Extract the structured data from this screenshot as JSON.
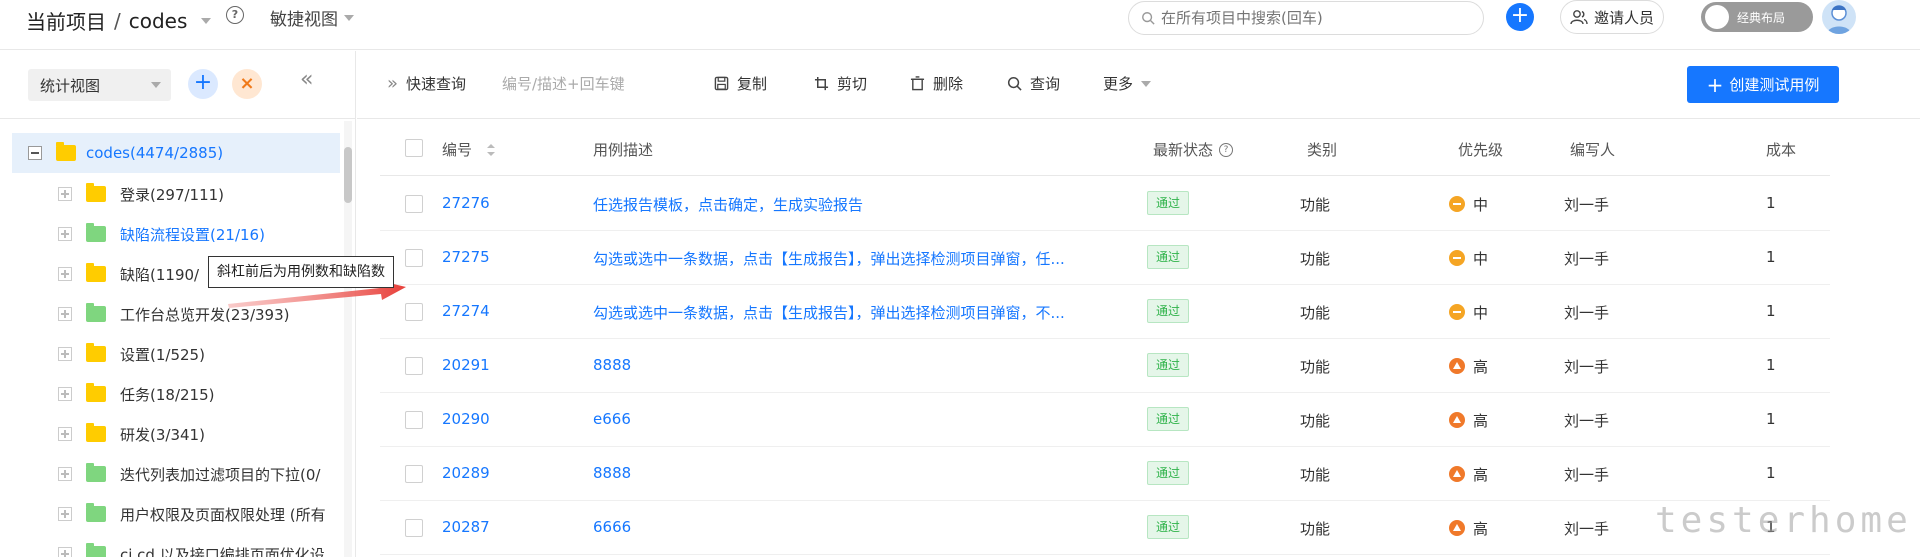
{
  "topbar": {
    "project_label": "当前项目",
    "separator": "/",
    "project_name": "codes",
    "help_icon": "question-circle-icon",
    "view_mode": "敏捷视图",
    "search_placeholder": "在所有项目中搜索(回车)",
    "invite_label": "邀请人员",
    "layout_toggle_label": "经典布局"
  },
  "sidebar": {
    "view_select": "统计视图",
    "root": {
      "label": "codes(4474/2885)"
    },
    "items": [
      {
        "label": "登录(297/111)",
        "color": "yellow",
        "link": false
      },
      {
        "label": "缺陷流程设置(21/16)",
        "color": "green",
        "link": true
      },
      {
        "label": "缺陷(1190/",
        "color": "yellow",
        "link": false
      },
      {
        "label": "工作台总览开发(23/393)",
        "color": "green",
        "link": false
      },
      {
        "label": "设置(1/525)",
        "color": "yellow",
        "link": false
      },
      {
        "label": "任务(18/215)",
        "color": "yellow",
        "link": false
      },
      {
        "label": "研发(3/341)",
        "color": "yellow",
        "link": false
      },
      {
        "label": "迭代列表加过滤项目的下拉(0/",
        "color": "green",
        "link": false
      },
      {
        "label": "用户权限及页面权限处理 (所有",
        "color": "green",
        "link": false
      },
      {
        "label": "ci cd 以及接口编排页面优化设",
        "color": "green",
        "link": false
      }
    ]
  },
  "toolbar": {
    "quick_query": "快速查询",
    "quick_query_placeholder": "编号/描述+回车键",
    "copy": "复制",
    "cut": "剪切",
    "delete": "删除",
    "query": "查询",
    "more": "更多",
    "create": "创建测试用例"
  },
  "table": {
    "headers": {
      "id": "编号",
      "desc": "用例描述",
      "status": "最新状态",
      "category": "类别",
      "priority": "优先级",
      "author": "编写人",
      "cost": "成本"
    },
    "rows": [
      {
        "id": "27276",
        "desc": "任选报告模板，点击确定，生成实验报告",
        "status": "通过",
        "category": "功能",
        "priority": "中",
        "priority_level": "mid",
        "author": "刘一手",
        "cost": "1"
      },
      {
        "id": "27275",
        "desc": "勾选或选中一条数据，点击【生成报告】，弹出选择检测项目弹窗，任...",
        "status": "通过",
        "category": "功能",
        "priority": "中",
        "priority_level": "mid",
        "author": "刘一手",
        "cost": "1"
      },
      {
        "id": "27274",
        "desc": "勾选或选中一条数据，点击【生成报告】，弹出选择检测项目弹窗，不...",
        "status": "通过",
        "category": "功能",
        "priority": "中",
        "priority_level": "mid",
        "author": "刘一手",
        "cost": "1"
      },
      {
        "id": "20291",
        "desc": "8888",
        "status": "通过",
        "category": "功能",
        "priority": "高",
        "priority_level": "high",
        "author": "刘一手",
        "cost": "1"
      },
      {
        "id": "20290",
        "desc": "e666",
        "status": "通过",
        "category": "功能",
        "priority": "高",
        "priority_level": "high",
        "author": "刘一手",
        "cost": "1"
      },
      {
        "id": "20289",
        "desc": "8888",
        "status": "通过",
        "category": "功能",
        "priority": "高",
        "priority_level": "high",
        "author": "刘一手",
        "cost": "1"
      },
      {
        "id": "20287",
        "desc": "6666",
        "status": "通过",
        "category": "功能",
        "priority": "高",
        "priority_level": "high",
        "author": "刘一手",
        "cost": "1"
      }
    ]
  },
  "annotation": {
    "tooltip": "斜杠前后为用例数和缺陷数"
  },
  "watermark": "testerhome.com",
  "colors": {
    "accent": "#1677ff",
    "pass_badge": "#2fb34a",
    "priority_mid": "#f5a524",
    "priority_high": "#f0792a",
    "arrow": "#e8403a"
  }
}
